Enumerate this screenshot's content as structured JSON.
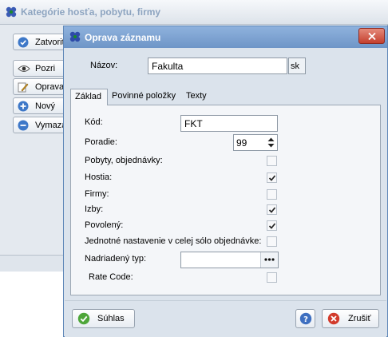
{
  "background_window": {
    "title": "Kategórie hosťa, pobytu, firmy",
    "buttons": [
      {
        "label": "Zatvoriť",
        "icon": "check-circle-icon"
      },
      {
        "label": "Pozri",
        "icon": "eye-icon"
      },
      {
        "label": "Oprava",
        "icon": "pencil-icon"
      },
      {
        "label": "Nový",
        "icon": "plus-circle-icon"
      },
      {
        "label": "Vymaza",
        "icon": "minus-circle-icon"
      }
    ]
  },
  "dialog": {
    "title": "Oprava záznamu",
    "name_label": "Názov:",
    "name_value": "Fakulta",
    "lang_badge": "sk",
    "tabs": [
      "Základ",
      "Povinné položky",
      "Texty"
    ],
    "active_tab": "Základ",
    "fields": {
      "kod_label": "Kód:",
      "kod_value": "FKT",
      "poradie_label": "Poradie:",
      "poradie_value": "99",
      "pobyty_label": "Pobyty, objednávky:",
      "pobyty_checked": false,
      "hostia_label": "Hostia:",
      "hostia_checked": true,
      "firmy_label": "Firmy:",
      "firmy_checked": false,
      "izby_label": "Izby:",
      "izby_checked": true,
      "povoleny_label": "Povolený:",
      "povoleny_checked": true,
      "jednotne_label": "Jednotné nastavenie v celej sólo objednávke:",
      "jednotne_checked": false,
      "nadriadeny_label": "Nadriadený typ:",
      "nadriadeny_value": "",
      "ellipsis": "•••",
      "rate_label": "Rate Code:",
      "rate_checked": false
    },
    "buttons": {
      "suhlas": "Súhlas",
      "zrusit": "Zrušiť"
    }
  },
  "colors": {
    "dialog_title": "#7aa0d0",
    "close_button": "#c94a38",
    "dialog_body": "#dbe3ec"
  }
}
